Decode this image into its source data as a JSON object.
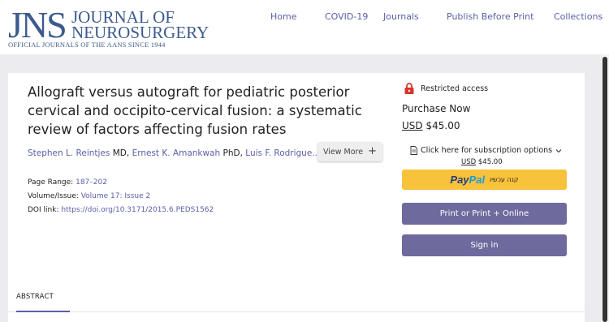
{
  "logo": {
    "abbr": "JNS",
    "title": "JOURNAL OF NEUROSURGERY",
    "tagline": "OFFICIAL JOURNALS OF THE AANS SINCE 1944",
    "color": "#3c5a8c"
  },
  "nav": [
    "Home",
    "COVID-19",
    "Journals",
    "Publish Before Print",
    "Collections"
  ],
  "article": {
    "title": "Allograft versus autograft for pediatric posterior cervical and occipito-cervical fusion: a systematic review of factors affecting fusion rates",
    "authors": [
      {
        "name": "Stephen L. Reintjes",
        "degree": "MD"
      },
      {
        "name": "Ernest K. Amankwah",
        "degree": "PhD"
      },
      {
        "name": "Luis F. Rodrigue...",
        "degree": ""
      }
    ],
    "view_more_label": "View More",
    "page_range_label": "Page Range:",
    "page_range": "187–202",
    "volume_label": "Volume/Issue:",
    "volume": "Volume 17: Issue 2",
    "doi_label": "DOI link:",
    "doi": "https://doi.org/10.3171/2015.6.PEDS1562"
  },
  "access": {
    "restricted_label": "Restricted access",
    "purchase_label": "Purchase Now",
    "currency": "USD",
    "price": "$45.00",
    "subscription_label": "Click here for subscription options",
    "paypal_part1": "Pay",
    "paypal_part2": "Pal",
    "paypal_hebrew": "קנה עכשיו",
    "print_button": "Print or Print + Online",
    "signin_button": "Sign in"
  },
  "tabs": {
    "abstract": "ABSTRACT"
  },
  "colors": {
    "accent": "#5a5ea8",
    "button": "#6e6a9e",
    "paypal": "#f8c23b",
    "lock": "#d7362b"
  }
}
